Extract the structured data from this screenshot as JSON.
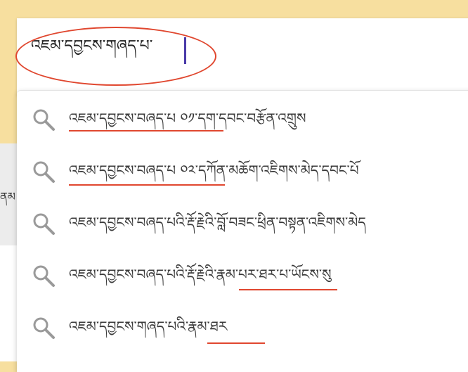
{
  "background": {
    "partial_text": "ནམ"
  },
  "search": {
    "query": "འཇམ་དབྱངས་གཞད་པ་"
  },
  "suggestions": [
    {
      "text": "འཇམ་དབྱངས་བཞད་པ ༠༡་དག་དབང་བརྩོན་འགྲུས"
    },
    {
      "text": "འཇམ་དབྱངས་བཞད་པ ༠༢་དཀོན་མཆོག་འཇིགས་མེད་དབང་པོ"
    },
    {
      "text": "འཇམ་དབྱངས་བཞད་པའི་རྡོ་རྗེའི་བློ་བཟང་ཕྲིན་བསྟན་འཇིགས་མེད"
    },
    {
      "text": "འཇམ་དབྱངས་བཞད་པའི་རྡོ་རྗེའི་རྣམ་པར་ཐར་པ་ཡོངས་སུ"
    },
    {
      "text": "འཇམ་དབྱངས་གཞད་པའི་རྣམ་ཐར"
    }
  ],
  "colors": {
    "accent_red": "#e0472f",
    "cursor": "#4a3aa8",
    "page_bg": "#f7df9f"
  },
  "icons": {
    "suggestion": "search-icon"
  }
}
